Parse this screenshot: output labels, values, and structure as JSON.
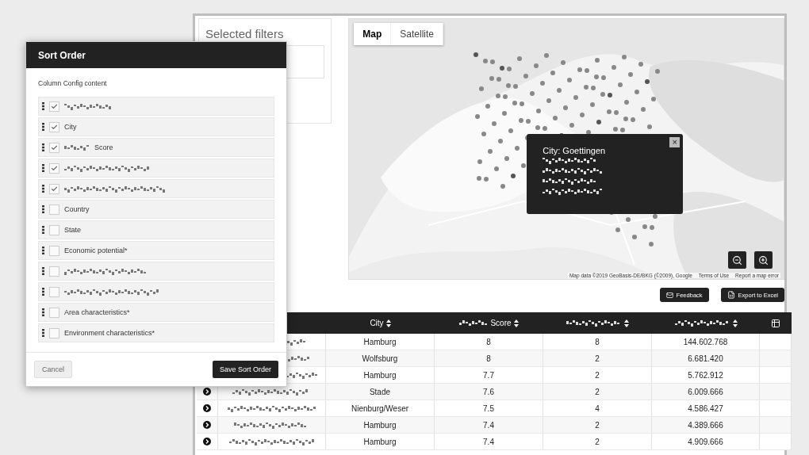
{
  "filters": {
    "title": "Selected filters"
  },
  "map": {
    "tabs": [
      {
        "label": "Map",
        "selected": true
      },
      {
        "label": "Satellite",
        "selected": false
      }
    ],
    "info": {
      "title": "City: Goettingen",
      "close": "×"
    },
    "attribution": [
      "Map data ©2019 GeoBasis-DE/BKG (©2009), Google",
      "Terms of Use",
      "Report a map error"
    ]
  },
  "toolbar": {
    "buttons": [
      {
        "label": "Feedback",
        "kind": "mail"
      },
      {
        "label": "Export to Excel",
        "kind": "excel"
      }
    ]
  },
  "table": {
    "columns": [
      {
        "label": "City",
        "kind": "sortable"
      },
      {
        "label": "Score",
        "kind": "blurred-sortable"
      },
      {
        "kind": "blurred-sortable"
      },
      {
        "kind": "blurred-sortable"
      }
    ],
    "rows": [
      {
        "cells": [
          "Hamburg",
          "8",
          "8",
          "144.602.768"
        ]
      },
      {
        "cells": [
          "Wolfsburg",
          "8",
          "2",
          "6.681.420"
        ]
      },
      {
        "cells": [
          "Hamburg",
          "7.7",
          "2",
          "5.762.912"
        ]
      },
      {
        "cells": [
          "Stade",
          "7.6",
          "2",
          "6.009.666"
        ]
      },
      {
        "cells": [
          "Nienburg/Weser",
          "7.5",
          "4",
          "4.586.427"
        ]
      },
      {
        "cells": [
          "Hamburg",
          "7.4",
          "2",
          "4.389.666"
        ]
      },
      {
        "cells": [
          "Hamburg",
          "7.4",
          "2",
          "4.909.666"
        ]
      }
    ]
  },
  "dialog": {
    "title": "Sort Order",
    "subtitle": "Column Config content",
    "items": [
      {
        "checked": true,
        "kind": "blurred"
      },
      {
        "label": "City",
        "checked": true,
        "kind": "text"
      },
      {
        "label": "Score",
        "checked": true,
        "kind": "blurred-prefix"
      },
      {
        "checked": true,
        "kind": "blurred"
      },
      {
        "checked": true,
        "kind": "blurred"
      },
      {
        "label": "Country",
        "checked": false,
        "kind": "text"
      },
      {
        "label": "State",
        "checked": false,
        "kind": "text"
      },
      {
        "label": "Economic potential*",
        "checked": false,
        "kind": "text"
      },
      {
        "checked": false,
        "kind": "blurred"
      },
      {
        "checked": false,
        "kind": "blurred"
      },
      {
        "label": "Area characteristics*",
        "checked": false,
        "kind": "text"
      },
      {
        "label": "Environment characteristics*",
        "checked": false,
        "kind": "text"
      }
    ],
    "cancel": "Cancel",
    "save": "Save Sort Order"
  }
}
